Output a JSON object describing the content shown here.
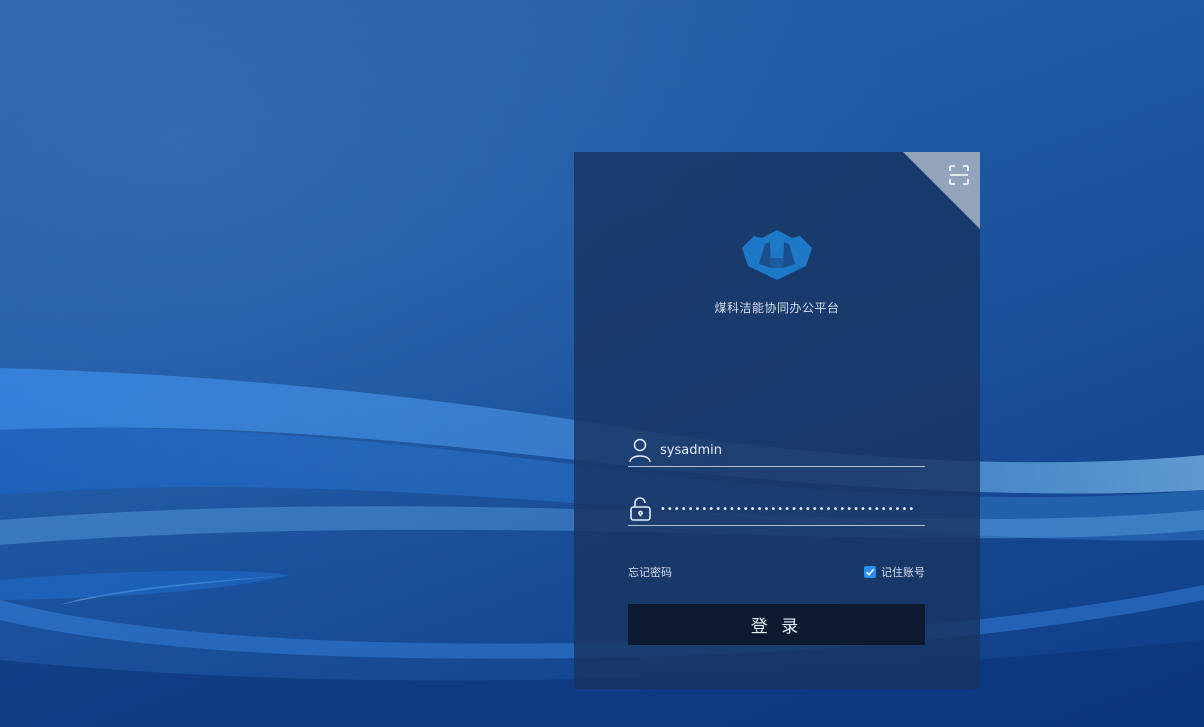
{
  "platform": {
    "title": "煤科洁能协同办公平台"
  },
  "login": {
    "username_value": "sysadmin",
    "password_value": "•••••••••••••••••••••••••••••••••••••",
    "forgot_label": "忘记密码",
    "remember_label": "记住账号",
    "remember_checked": true,
    "submit_label": "登 录"
  },
  "icons": {
    "corner": "qr-scan-icon",
    "user": "user-icon",
    "password": "unlock-icon",
    "logo": "company-logo"
  },
  "colors": {
    "accent": "#2f8df0",
    "logo": "#1d78c8",
    "button": "#0d1a30",
    "panel": "#183460"
  }
}
